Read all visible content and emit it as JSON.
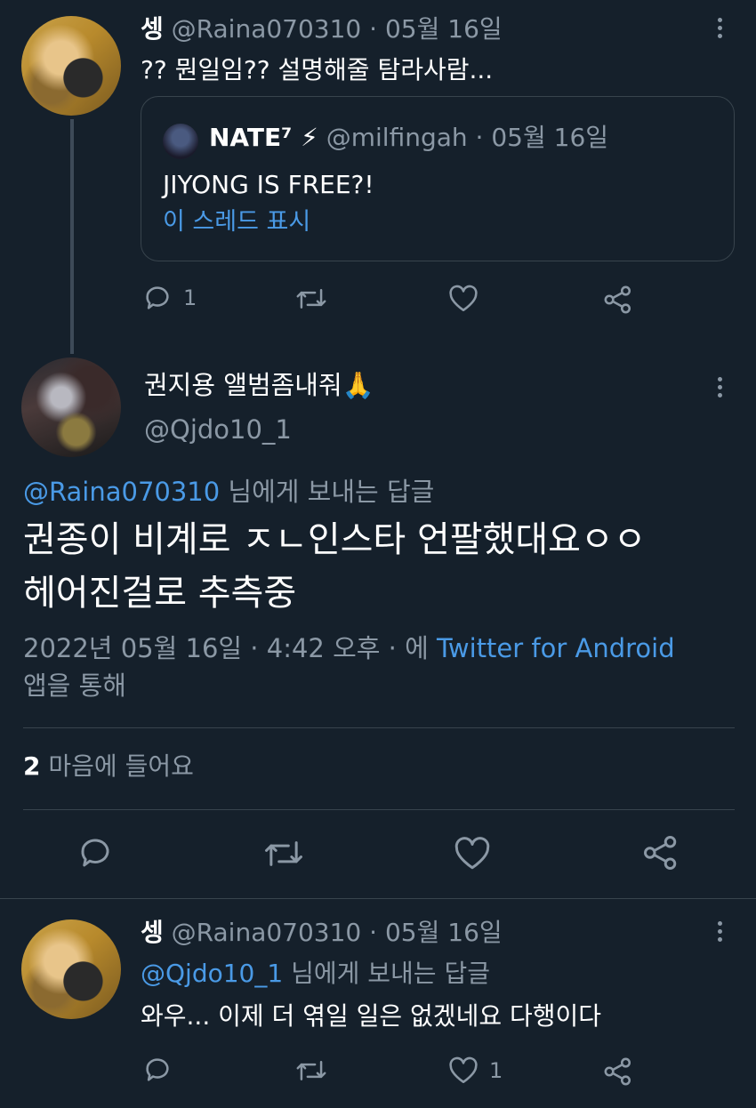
{
  "tweet1": {
    "display_name": "셍",
    "handle": "@Raina070310",
    "separator": "·",
    "date": "05월 16일",
    "text": "?? 뭔일임?? 설명해줄 탐라사람...",
    "quote": {
      "display_name": "NATE⁷ ⚡",
      "handle": "@milfingah",
      "separator": "·",
      "date": "05월 16일",
      "text": "JIYONG IS FREE?!",
      "show_thread": "이 스레드 표시"
    },
    "reply_count": "1",
    "retweet_count": "",
    "like_count": ""
  },
  "main_tweet": {
    "display_name": "권지용 앨범좀내줘🙏",
    "handle": "@Qjdo10_1",
    "reply_to_handle": "@Raina070310",
    "reply_to_suffix": "님에게 보내는 답글",
    "text_line1": "권종이 비계로 ㅈㄴ인스타 언팔했대요ㅇㅇ",
    "text_line2": "헤어진걸로 추측중",
    "timestamp": "2022년 05월 16일 · 4:42 오후 · 에",
    "source": "Twitter for Android",
    "source_suffix": "앱을 통해",
    "like_count": "2",
    "like_label": "마음에 들어요"
  },
  "tweet3": {
    "display_name": "셍",
    "handle": "@Raina070310",
    "separator": "·",
    "date": "05월 16일",
    "reply_to_handle": "@Qjdo10_1",
    "reply_to_suffix": "님에게 보내는 답글",
    "text": "와우... 이제 더 엮일 일은 없겠네요 다행이다",
    "reply_count": "",
    "retweet_count": "",
    "like_count": "1"
  },
  "icons": {
    "reply": "reply-icon",
    "retweet": "retweet-icon",
    "like": "heart-icon",
    "share": "share-icon",
    "more": "more-icon"
  },
  "colors": {
    "background": "#15202b",
    "link": "#4a9ae6",
    "muted": "#8b98a5",
    "border": "#38444d"
  }
}
